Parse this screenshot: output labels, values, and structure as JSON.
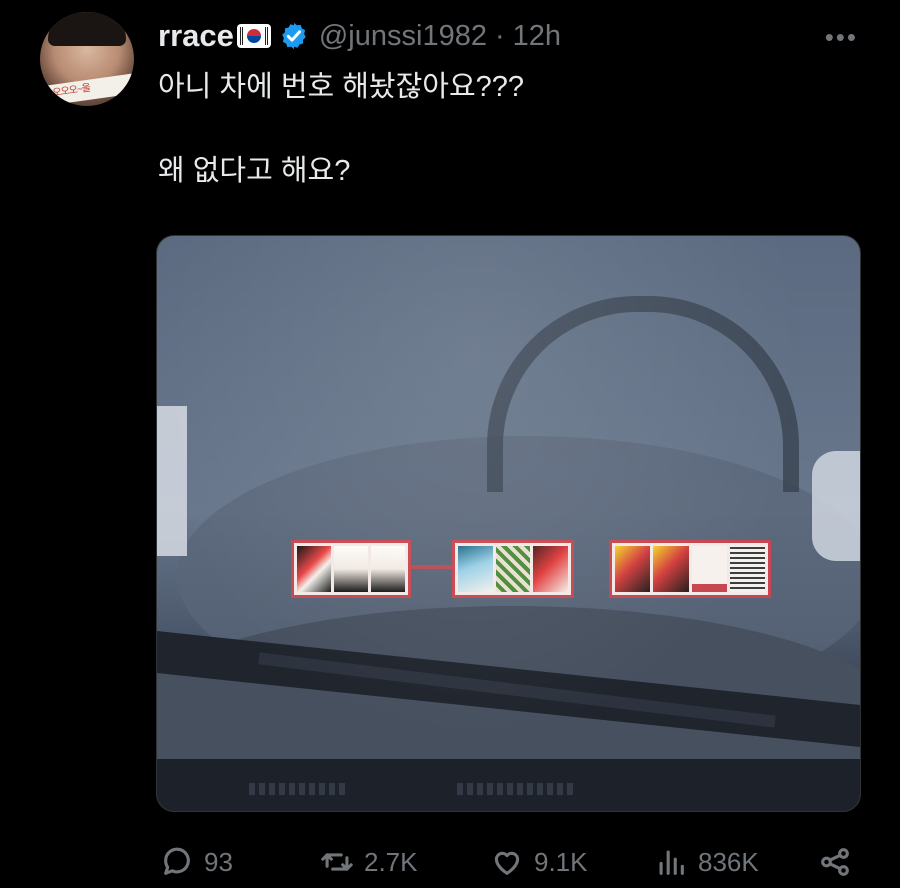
{
  "user": {
    "name": "rrace",
    "handle": "@junssi1982",
    "separator": "·",
    "time": "12h",
    "verified": true
  },
  "avatar": {
    "text": "오오오오~올"
  },
  "tweet": {
    "lines": [
      "아니 차에 번호 해놨잖아요???",
      "왜 없다고 해요?"
    ]
  },
  "menu": {
    "more": "•••"
  },
  "actions": [
    {
      "name": "reply",
      "icon": "reply-icon",
      "count": "93"
    },
    {
      "name": "retweet",
      "icon": "retweet-icon",
      "count": "2.7K"
    },
    {
      "name": "like",
      "icon": "heart-icon",
      "count": "9.1K"
    },
    {
      "name": "views",
      "icon": "views-icon",
      "count": "836K"
    },
    {
      "name": "share",
      "icon": "share-icon",
      "count": ""
    }
  ],
  "colors": {
    "background": "#000000",
    "text": "#e7e9ea",
    "muted": "#71767b",
    "verified": "#1d9bf0"
  }
}
